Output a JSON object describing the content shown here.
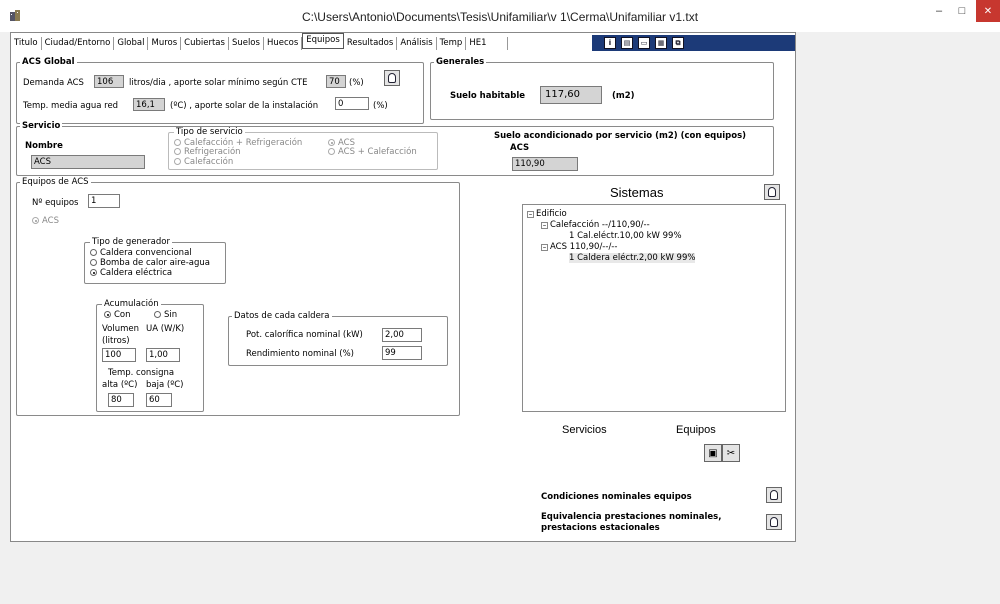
{
  "window": {
    "title": "C:\\Users\\Antonio\\Documents\\Tesis\\Unifamiliar\\v 1\\Cerma\\Unifamiliar v1.txt",
    "minimize": "–",
    "maximize": "□",
    "close": "✕"
  },
  "tabs": [
    "Titulo",
    "Ciudad/Entorno",
    "Global",
    "Muros",
    "Cubiertas",
    "Suelos",
    "Huecos",
    "Equipos",
    "Resultados",
    "Análisis",
    "Temp",
    "HE1"
  ],
  "toolbar_icons": [
    "info-icon",
    "document-icon",
    "window-icon",
    "save-icon",
    "copy-icon"
  ],
  "acs_global": {
    "title": "ACS Global",
    "demanda_label": "Demanda ACS",
    "demanda_value": "106",
    "demanda_text": "litros/dia , aporte solar mínimo según CTE",
    "aporte_min_value": "70",
    "aporte_min_unit": "(%)",
    "temp_label": "Temp. media agua red",
    "temp_value": "16,1",
    "temp_text": "(ºC) , aporte solar de la instalación",
    "aporte_inst_value": "0",
    "aporte_inst_unit": "(%)"
  },
  "generales": {
    "title": "Generales",
    "suelo_label": "Suelo habitable",
    "suelo_value": "117,60",
    "suelo_unit": "(m2)"
  },
  "servicio": {
    "title": "Servicio",
    "nombre_label": "Nombre",
    "nombre_value": "ACS",
    "tipo_title": "Tipo de servicio",
    "tipos": [
      "Calefacción + Refrigeración",
      "Refrigeración",
      "Calefacción",
      "ACS",
      "ACS + Calefacción"
    ],
    "suelo_acond_label": "Suelo acondicionado por servicio (m2)  (con equipos)",
    "suelo_acond_sub": "ACS",
    "suelo_acond_value": "110,90"
  },
  "equipos": {
    "title": "Equipos de ACS",
    "num_label": "Nº equipos",
    "num_value": "1",
    "acs_option": "ACS",
    "generador_title": "Tipo de generador",
    "generadores": [
      "Caldera convencional",
      "Bomba de calor aire-agua",
      "Caldera eléctrica"
    ],
    "acum_title": "Acumulación",
    "acum_con": "Con",
    "acum_sin": "Sin",
    "volumen_label": "Volumen",
    "volumen_label2": "(litros)",
    "ua_label": "UA (W/K)",
    "volumen_value": "100",
    "ua_value": "1,00",
    "temp_consigna_label": "Temp. consigna",
    "alta_label": "alta (ºC)",
    "baja_label": "baja (ºC)",
    "alta_value": "80",
    "baja_value": "60",
    "caldera_title": "Datos de cada caldera",
    "pot_label": "Pot. calorífica nominal (kW)",
    "pot_value": "2,00",
    "rend_label": "Rendimiento nominal (%)",
    "rend_value": "99"
  },
  "sistemas": {
    "title": "Sistemas",
    "tree": [
      "Edificio",
      "Calefacción --/110,90/--",
      "1 Cal.eléctr.10,00 kW 99%",
      "ACS 110,90/--/--",
      "1 Caldera eléctr.2,00 kW 99%"
    ]
  },
  "bottom": {
    "servicios": "Servicios",
    "equipos": "Equipos",
    "cond_nominales": "Condiciones nominales equipos",
    "equivalencia": "Equivalencia prestaciones nominales, prestacions estacionales"
  }
}
